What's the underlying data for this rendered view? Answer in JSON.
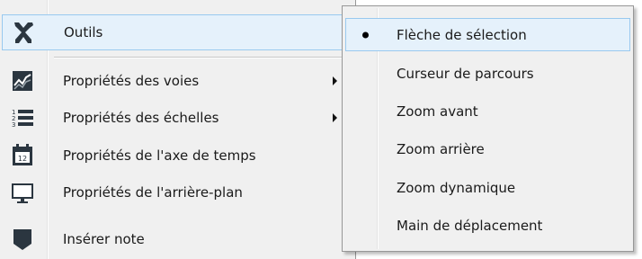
{
  "main_menu": {
    "items": [
      {
        "label": "Outils",
        "icon": "tools-icon",
        "has_submenu": false,
        "highlighted": true
      },
      {
        "label": "Propriétés des voies",
        "icon": "waveform-icon",
        "has_submenu": true
      },
      {
        "label": "Propriétés des échelles",
        "icon": "numbered-list-icon",
        "has_submenu": true
      },
      {
        "label": "Propriétés de l'axe de temps",
        "icon": "calendar-icon",
        "calendar_day": "12",
        "has_submenu": false
      },
      {
        "label": "Propriétés de l'arrière-plan",
        "icon": "monitor-icon",
        "has_submenu": false
      },
      {
        "label": "Insérer note",
        "icon": "note-icon",
        "has_submenu": false
      }
    ]
  },
  "submenu": {
    "items": [
      {
        "label": "Flèche de sélection",
        "selected": true,
        "highlighted": true
      },
      {
        "label": "Curseur de parcours"
      },
      {
        "label": "Zoom avant"
      },
      {
        "label": "Zoom arrière"
      },
      {
        "label": "Zoom dynamique"
      },
      {
        "label": "Main de déplacement"
      }
    ]
  },
  "colors": {
    "menu_bg": "#f0f0f0",
    "highlight_bg": "#e5f1fb",
    "highlight_border": "#99c9ef",
    "icon_dark": "#2b3640"
  }
}
